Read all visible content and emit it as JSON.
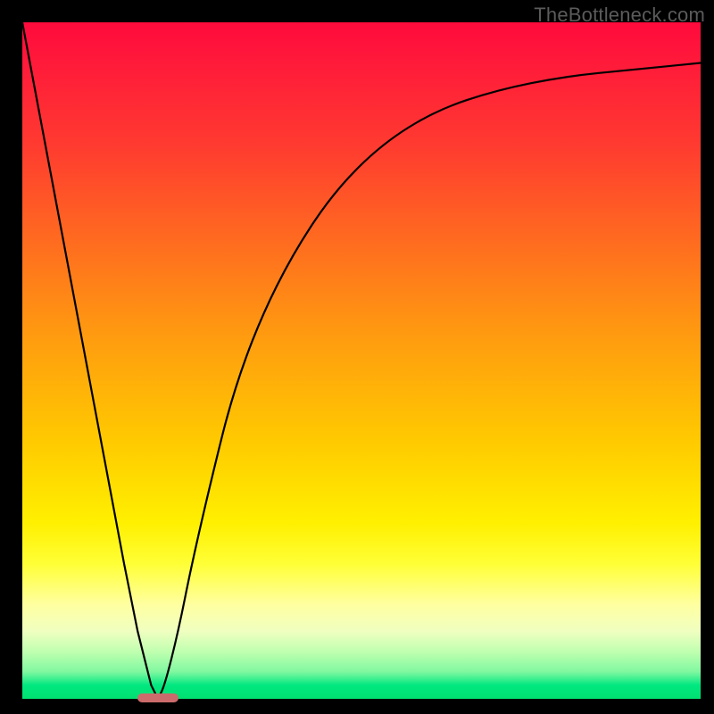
{
  "watermark": "TheBottleneck.com",
  "chart_data": {
    "type": "line",
    "title": "",
    "xlabel": "",
    "ylabel": "",
    "xlim": [
      0,
      100
    ],
    "ylim": [
      0,
      100
    ],
    "grid": false,
    "legend": false,
    "series": [
      {
        "name": "bottleneck-curve",
        "x": [
          0,
          3,
          6,
          9,
          12,
          15,
          17,
          19,
          20,
          21,
          23,
          25,
          28,
          31,
          35,
          40,
          46,
          53,
          61,
          70,
          80,
          90,
          100
        ],
        "y": [
          100,
          84,
          68,
          52,
          36,
          20,
          10,
          2,
          0,
          2,
          10,
          20,
          33,
          45,
          56,
          66,
          75,
          82,
          87,
          90,
          92,
          93,
          94
        ]
      }
    ],
    "marker": {
      "name": "optimum-marker",
      "x_center": 20,
      "width_pct": 6,
      "y": 0,
      "height_pct": 1.2,
      "color": "#cc6b6b"
    },
    "background": {
      "type": "vertical-gradient",
      "stops": [
        {
          "pos": 0,
          "color": "#ff0a3c"
        },
        {
          "pos": 18,
          "color": "#ff3a30"
        },
        {
          "pos": 46,
          "color": "#ff9a10"
        },
        {
          "pos": 74,
          "color": "#fff000"
        },
        {
          "pos": 90,
          "color": "#f0ffc0"
        },
        {
          "pos": 100,
          "color": "#00e070"
        }
      ]
    }
  }
}
